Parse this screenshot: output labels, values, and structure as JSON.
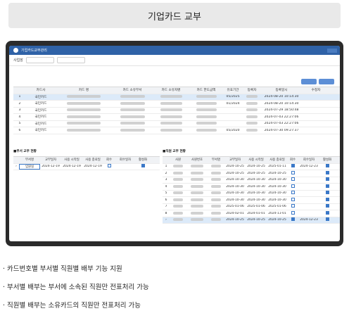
{
  "banner": {
    "title": "기업카드 교부"
  },
  "app": {
    "title": "기업카드교부관리",
    "filter_label": "사업장"
  },
  "main_grid": {
    "headers": [
      "카드사",
      "카드 명",
      "카드 소유부서",
      "카드 소유자명",
      "카드 한도금액",
      "유효기간",
      "등록자",
      "등록일시",
      "수정자"
    ],
    "rows": [
      {
        "num": "1",
        "card": "국민카드",
        "expiry": "05/2025",
        "reg": "2024-08-20 10:14:30"
      },
      {
        "num": "2",
        "card": "국민카드",
        "expiry": "01/2024",
        "reg": "2024-08-20 10:14:30"
      },
      {
        "num": "3",
        "card": "국민카드",
        "expiry": "",
        "reg": "2024-07-29 18:50:48"
      },
      {
        "num": "4",
        "card": "국민카드",
        "expiry": "",
        "reg": "2024-07-03 22:27:06"
      },
      {
        "num": "5",
        "card": "국민카드",
        "expiry": "",
        "reg": "2024-07-03 22:27:06"
      },
      {
        "num": "6",
        "card": "국민카드",
        "expiry": "05/2020",
        "reg": "2024-07-30 09:27:37"
      }
    ]
  },
  "dept_grid": {
    "title": "■부서 교부 현황",
    "headers": [
      "부서명",
      "교부일자",
      "사용 시작일",
      "사용 종료일",
      "회수",
      "회수일자",
      "활성화"
    ],
    "rows": [
      {
        "dept": "임원실",
        "issue": "2024-12-19",
        "start": "2024-12-19",
        "end": "2024-12-19"
      }
    ]
  },
  "emp_grid": {
    "title": "■직원 교부 현황",
    "headers": [
      "사원",
      "사원번호",
      "부서명",
      "교부일자",
      "사용 시작일",
      "사용 종료일",
      "회수",
      "회수일자",
      "활성화"
    ],
    "rows": [
      {
        "num": "1",
        "issue": "2024-10-25",
        "start": "2024-10-25",
        "end": "2025-01-11",
        "ret": "2024-12-23",
        "retOn": true
      },
      {
        "num": "2",
        "issue": "2024-10-25",
        "start": "2024-10-25",
        "end": "2024-10-25",
        "ret": "",
        "retOn": false
      },
      {
        "num": "3",
        "issue": "2024-10-30",
        "start": "2024-10-30",
        "end": "2024-10-30",
        "ret": "",
        "retOn": false
      },
      {
        "num": "4",
        "issue": "2024-10-30",
        "start": "2024-10-30",
        "end": "2024-10-30",
        "ret": "",
        "retOn": false
      },
      {
        "num": "5",
        "issue": "2024-10-30",
        "start": "2024-10-30",
        "end": "2024-10-30",
        "ret": "",
        "retOn": false
      },
      {
        "num": "6",
        "issue": "2024-10-30",
        "start": "2024-10-30",
        "end": "2024-10-30",
        "ret": "",
        "retOn": false
      },
      {
        "num": "7",
        "issue": "2025-01-06",
        "start": "2025-01-06",
        "end": "2025-01-06",
        "ret": "",
        "retOn": false
      },
      {
        "num": "8",
        "issue": "2024-02-01",
        "start": "2024-01-01",
        "end": "2024-11-01",
        "ret": "",
        "retOn": false
      },
      {
        "num": "",
        "issue": "2024-10-25",
        "start": "2024-10-25",
        "end": "2024-10-25",
        "ret": "2024-12-23",
        "retOn": true
      }
    ]
  },
  "bullets": [
    "· 카드번호별 부서별 직원별 배부 기능 지원",
    "· 부서별 배부는 부서에 소속된 직원만 전표처리 가능",
    "· 직원별 배부는 소유카드의 직원만 전표처리 가능"
  ],
  "colors": {
    "titlebar": "#2f62a7",
    "selection": "#dceaf9",
    "banner": "#e9e9e9"
  }
}
